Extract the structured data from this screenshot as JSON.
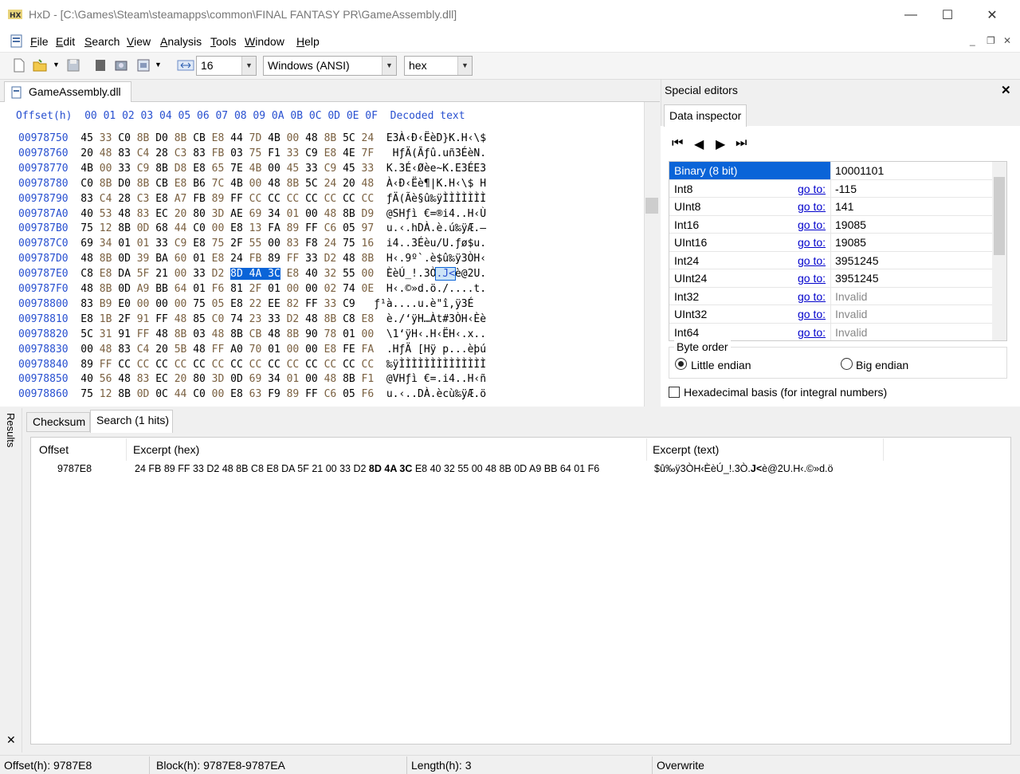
{
  "window": {
    "title": "HxD - [C:\\Games\\Steam\\steamapps\\common\\FINAL FANTASY PR\\GameAssembly.dll]",
    "minimize": "—",
    "maximize": "☐",
    "close": "✕"
  },
  "menu": {
    "items": [
      "File",
      "Edit",
      "Search",
      "View",
      "Analysis",
      "Tools",
      "Window",
      "Help"
    ],
    "mdi_minimize": "_",
    "mdi_restore": "❐",
    "mdi_close": "✕"
  },
  "toolbar": {
    "bytes_per_row": "16",
    "charset": "Windows (ANSI)",
    "offset_base": "hex"
  },
  "document_tab": {
    "label": "GameAssembly.dll"
  },
  "hex_editor": {
    "header_offset": "Offset(h)",
    "header_columns": "00 01 02 03 04 05 06 07 08 09 0A 0B 0C 0D 0E 0F",
    "header_decoded": "Decoded text",
    "rows": [
      {
        "offset": "00978750",
        "bytes": [
          "45",
          "33",
          "C0",
          "8B",
          "D0",
          "8B",
          "CB",
          "E8",
          "44",
          "7D",
          "4B",
          "00",
          "48",
          "8B",
          "5C",
          "24"
        ],
        "text": "E3À‹Ð‹ËèD}K.H‹\\$"
      },
      {
        "offset": "00978760",
        "bytes": [
          "20",
          "48",
          "83",
          "C4",
          "28",
          "C3",
          "83",
          "FB",
          "03",
          "75",
          "F1",
          "33",
          "C9",
          "E8",
          "4E",
          "7F"
        ],
        "text": " HƒÄ(Ãƒû.uñ3ÉèN."
      },
      {
        "offset": "00978770",
        "bytes": [
          "4B",
          "00",
          "33",
          "C9",
          "8B",
          "D8",
          "E8",
          "65",
          "7E",
          "4B",
          "00",
          "45",
          "33",
          "C9",
          "45",
          "33"
        ],
        "text": "K.3É‹Øèe~K.E3ÉE3"
      },
      {
        "offset": "00978780",
        "bytes": [
          "C0",
          "8B",
          "D0",
          "8B",
          "CB",
          "E8",
          "B6",
          "7C",
          "4B",
          "00",
          "48",
          "8B",
          "5C",
          "24",
          "20",
          "48"
        ],
        "text": "À‹Ð‹Ëè¶|K.H‹\\$ H"
      },
      {
        "offset": "00978790",
        "bytes": [
          "83",
          "C4",
          "28",
          "C3",
          "E8",
          "A7",
          "FB",
          "89",
          "FF",
          "CC",
          "CC",
          "CC",
          "CC",
          "CC",
          "CC",
          "CC"
        ],
        "text": "ƒÄ(Ãè§û‰ÿÌÌÌÌÌÌÌ"
      },
      {
        "offset": "009787A0",
        "bytes": [
          "40",
          "53",
          "48",
          "83",
          "EC",
          "20",
          "80",
          "3D",
          "AE",
          "69",
          "34",
          "01",
          "00",
          "48",
          "8B",
          "D9"
        ],
        "text": "@SHƒì €=®i4..H‹Ù"
      },
      {
        "offset": "009787B0",
        "bytes": [
          "75",
          "12",
          "8B",
          "0D",
          "68",
          "44",
          "C0",
          "00",
          "E8",
          "13",
          "FA",
          "89",
          "FF",
          "C6",
          "05",
          "97"
        ],
        "text": "u.‹.hDÀ.è.ú‰ÿÆ.—"
      },
      {
        "offset": "009787C0",
        "bytes": [
          "69",
          "34",
          "01",
          "01",
          "33",
          "C9",
          "E8",
          "75",
          "2F",
          "55",
          "00",
          "83",
          "F8",
          "24",
          "75",
          "16"
        ],
        "text": "i4..3Éèu/U.ƒø$u."
      },
      {
        "offset": "009787D0",
        "bytes": [
          "48",
          "8B",
          "0D",
          "39",
          "BA",
          "60",
          "01",
          "E8",
          "24",
          "FB",
          "89",
          "FF",
          "33",
          "D2",
          "48",
          "8B"
        ],
        "text": "H‹.9º`.è$û‰ÿ3ÒH‹"
      },
      {
        "offset": "009787E0",
        "bytes": [
          "C8",
          "E8",
          "DA",
          "5F",
          "21",
          "00",
          "33",
          "D2",
          "8D",
          "4A",
          "3C",
          "E8",
          "40",
          "32",
          "55",
          "00"
        ],
        "text": "ÈèÚ_!.3Ò.J<è@2U."
      },
      {
        "offset": "009787F0",
        "bytes": [
          "48",
          "8B",
          "0D",
          "A9",
          "BB",
          "64",
          "01",
          "F6",
          "81",
          "2F",
          "01",
          "00",
          "00",
          "02",
          "74",
          "0E"
        ],
        "text": "H‹.©»d.ö./....t."
      },
      {
        "offset": "00978800",
        "bytes": [
          "83",
          "B9",
          "E0",
          "00",
          "00",
          "00",
          "75",
          "05",
          "E8",
          "22",
          "EE",
          "82",
          "FF",
          "33",
          "C9"
        ],
        "text": "ƒ¹à....u.è\"î‚ÿ3É"
      },
      {
        "offset": "00978810",
        "bytes": [
          "E8",
          "1B",
          "2F",
          "91",
          "FF",
          "48",
          "85",
          "C0",
          "74",
          "23",
          "33",
          "D2",
          "48",
          "8B",
          "C8",
          "E8"
        ],
        "text": "è./‘ÿH…Àt#3ÒH‹Èè"
      },
      {
        "offset": "00978820",
        "bytes": [
          "5C",
          "31",
          "91",
          "FF",
          "48",
          "8B",
          "03",
          "48",
          "8B",
          "CB",
          "48",
          "8B",
          "90",
          "78",
          "01",
          "00"
        ],
        "text": "\\1‘ÿH‹.H‹ËH‹.x.."
      },
      {
        "offset": "00978830",
        "bytes": [
          "00",
          "48",
          "83",
          "C4",
          "20",
          "5B",
          "48",
          "FF",
          "A0",
          "70",
          "01",
          "00",
          "00",
          "E8",
          "FE",
          "FA"
        ],
        "text": ".HƒÄ [Hÿ p...èþú"
      },
      {
        "offset": "00978840",
        "bytes": [
          "89",
          "FF",
          "CC",
          "CC",
          "CC",
          "CC",
          "CC",
          "CC",
          "CC",
          "CC",
          "CC",
          "CC",
          "CC",
          "CC",
          "CC",
          "CC"
        ],
        "text": "‰ÿÌÌÌÌÌÌÌÌÌÌÌÌÌÌ"
      },
      {
        "offset": "00978850",
        "bytes": [
          "40",
          "56",
          "48",
          "83",
          "EC",
          "20",
          "80",
          "3D",
          "0D",
          "69",
          "34",
          "01",
          "00",
          "48",
          "8B",
          "F1"
        ],
        "text": "@VHƒì €=.i4..H‹ñ"
      },
      {
        "offset": "00978860",
        "bytes": [
          "75",
          "12",
          "8B",
          "0D",
          "0C",
          "44",
          "C0",
          "00",
          "E8",
          "63",
          "F9",
          "89",
          "FF",
          "C6",
          "05",
          "F6"
        ],
        "text": "u.‹..DÀ.ècù‰ÿÆ.ö"
      }
    ]
  },
  "special_editors": {
    "title": "Special editors",
    "close": "✕",
    "tab": "Data inspector",
    "nav": [
      "⏮",
      "◀",
      "▶",
      "⏭"
    ],
    "rows": [
      {
        "name": "Binary (8 bit)",
        "goto": "",
        "value": "10001101",
        "selected": true
      },
      {
        "name": "Int8",
        "goto": "go to:",
        "value": "-115"
      },
      {
        "name": "UInt8",
        "goto": "go to:",
        "value": "141"
      },
      {
        "name": "Int16",
        "goto": "go to:",
        "value": "19085"
      },
      {
        "name": "UInt16",
        "goto": "go to:",
        "value": "19085"
      },
      {
        "name": "Int24",
        "goto": "go to:",
        "value": "3951245"
      },
      {
        "name": "UInt24",
        "goto": "go to:",
        "value": "3951245"
      },
      {
        "name": "Int32",
        "goto": "go to:",
        "value": "Invalid",
        "invalid": true
      },
      {
        "name": "UInt32",
        "goto": "go to:",
        "value": "Invalid",
        "invalid": true
      },
      {
        "name": "Int64",
        "goto": "go to:",
        "value": "Invalid",
        "invalid": true
      }
    ],
    "byte_order_label": "Byte order",
    "little_endian": "Little endian",
    "big_endian": "Big endian",
    "hex_basis": "Hexadecimal basis (for integral numbers)"
  },
  "results": {
    "side_label": "Results",
    "close": "✕",
    "tabs": [
      "Checksum",
      "Search (1 hits)"
    ],
    "columns": [
      "Offset",
      "Excerpt (hex)",
      "Excerpt (text)"
    ],
    "row": {
      "offset": "9787E8",
      "hex_pre": "24 FB 89 FF 33 D2 48 8B C8 E8 DA 5F 21 00 33 D2 ",
      "hex_match": "8D 4A 3C",
      "hex_post": " E8 40 32 55 00 48 8B 0D A9 BB 64 01 F6",
      "text_pre": "$û‰ÿ3ÒH‹ÈèÚ_!.3Ò.",
      "text_match": "J<",
      "text_post": "è@2U.H‹.©»d.ö"
    }
  },
  "status": {
    "offset": "Offset(h): 9787E8",
    "block": "Block(h): 9787E8-9787EA",
    "length": "Length(h): 3",
    "mode": "Overwrite"
  }
}
